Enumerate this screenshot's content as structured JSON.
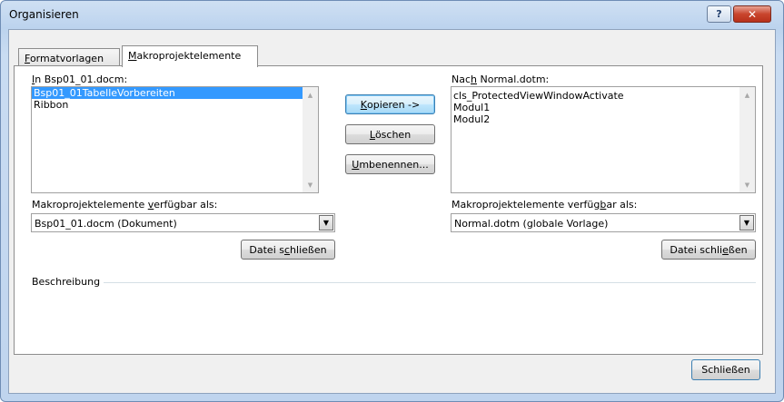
{
  "window": {
    "title": "Organisieren",
    "help_glyph": "?",
    "close_glyph": "✕"
  },
  "tabs": [
    {
      "pre": "",
      "u": "F",
      "post": "ormatvorlagen"
    },
    {
      "pre": "",
      "u": "M",
      "post": "akroprojektelemente"
    }
  ],
  "left": {
    "list_label": {
      "pre": "",
      "u": "I",
      "post": "n Bsp01_01.docm:"
    },
    "items": [
      "Bsp01_01TabelleVorbereiten",
      "Ribbon"
    ],
    "selected_index": 0,
    "available_label": {
      "pre": "Makroprojektelemente ",
      "u": "v",
      "post": "erfügbar als:"
    },
    "available_value": "Bsp01_01.docm (Dokument)",
    "close_file": {
      "pre": "Datei s",
      "u": "c",
      "post": "hließen"
    }
  },
  "right": {
    "list_label": {
      "pre": "Nac",
      "u": "h",
      "post": " Normal.dotm:"
    },
    "items": [
      "cls_ProtectedViewWindowActivate",
      "Modul1",
      "Modul2"
    ],
    "available_label": {
      "pre": "Makroprojektelemente verfüg",
      "u": "b",
      "post": "ar als:"
    },
    "available_value": "Normal.dotm (globale Vorlage)",
    "close_file": {
      "pre": "Datei schli",
      "u": "e",
      "post": "ßen"
    }
  },
  "actions": {
    "copy": {
      "pre": "",
      "u": "K",
      "post": "opieren ->"
    },
    "delete": {
      "pre": "",
      "u": "L",
      "post": "öschen"
    },
    "rename": {
      "pre": "",
      "u": "U",
      "post": "mbenennen..."
    }
  },
  "description_label": "Beschreibung",
  "close_button": "Schließen",
  "icons": {
    "scroll_up": "▲",
    "scroll_down": "▼",
    "dropdown": "▼"
  }
}
